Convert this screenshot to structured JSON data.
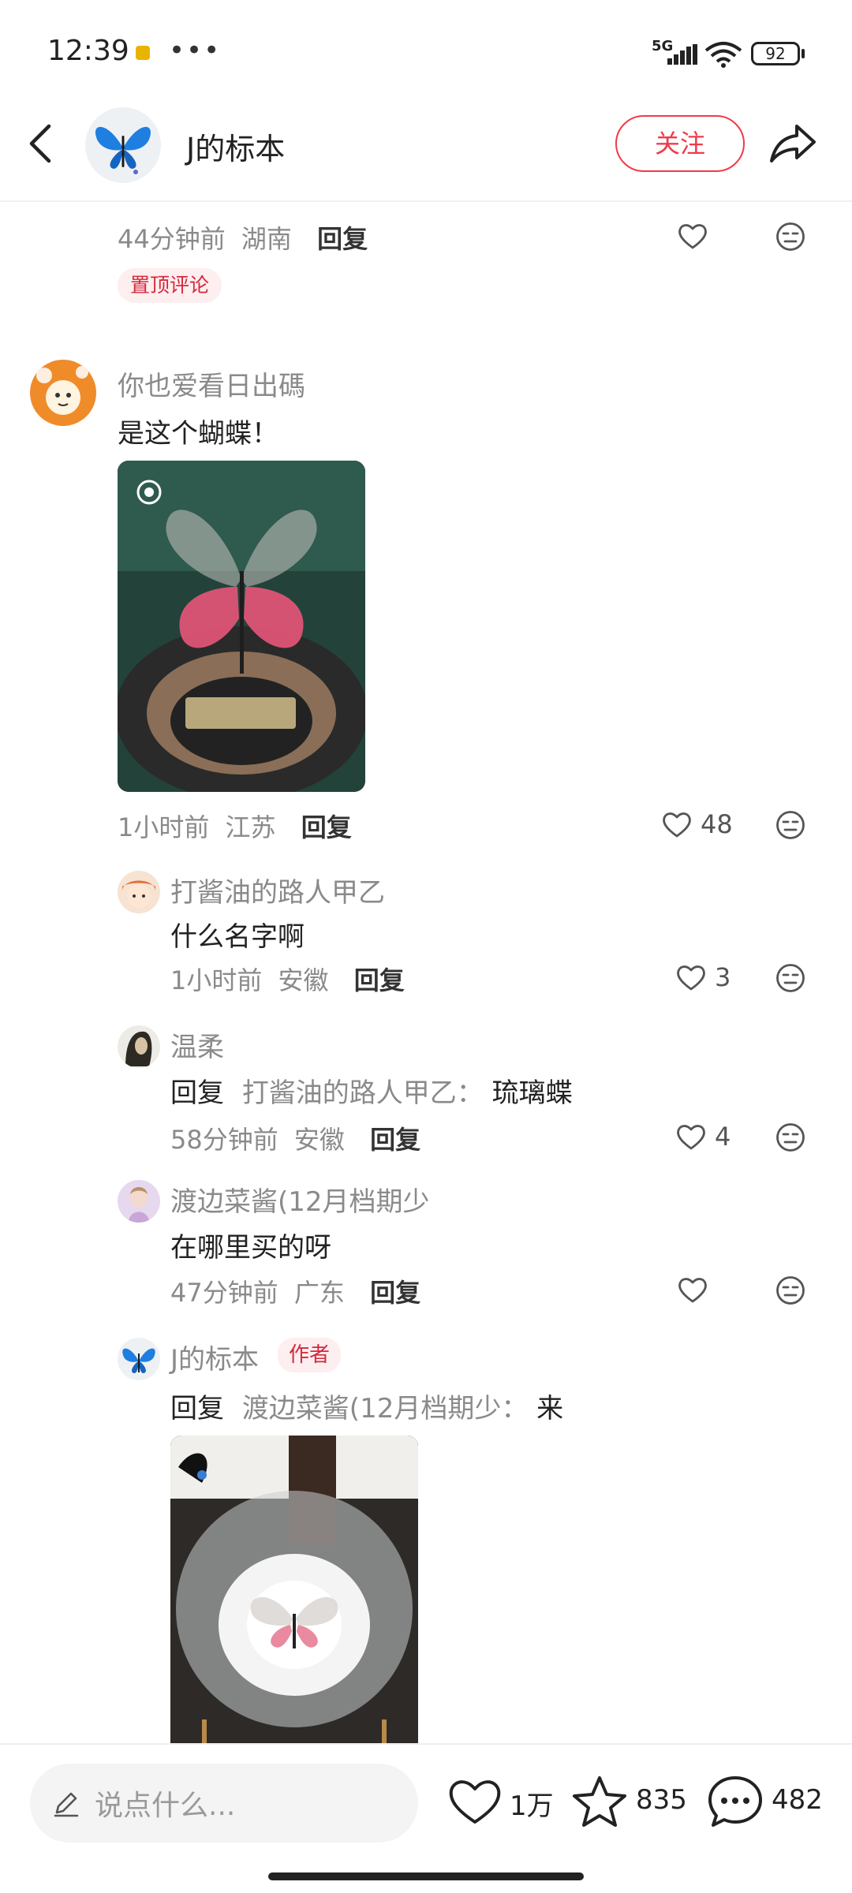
{
  "status": {
    "time": "12:39",
    "network": "5G",
    "battery": "92"
  },
  "header": {
    "author": "J的标本",
    "follow": "关注"
  },
  "pinned": {
    "time": "44分钟前",
    "location": "湖南",
    "reply": "回复",
    "badge": "置顶评论"
  },
  "comment1": {
    "user": "你也爱看日出碼",
    "text": "是这个蝴蝶！",
    "time": "1小时前",
    "location": "江苏",
    "reply": "回复",
    "likes": "48"
  },
  "replies": [
    {
      "user": "打酱油的路人甲乙",
      "text": "什么名字啊",
      "time": "1小时前",
      "location": "安徽",
      "reply": "回复",
      "likes": "3"
    },
    {
      "user": "温柔",
      "text_prefix": "回复",
      "text_target": "打酱油的路人甲乙：",
      "text_body": "琉璃蝶",
      "time": "58分钟前",
      "location": "安徽",
      "reply": "回复",
      "likes": "4"
    },
    {
      "user": "渡边菜酱(12月档期少",
      "text": "在哪里买的呀",
      "time": "47分钟前",
      "location": "广东",
      "reply": "回复",
      "likes": ""
    },
    {
      "user": "J的标本",
      "badge": "作者",
      "text_prefix": "回复",
      "text_target": "渡边菜酱(12月档期少：",
      "text_body": "来"
    }
  ],
  "bottom": {
    "placeholder": "说点什么...",
    "likes": "1万",
    "stars": "835",
    "comments": "482"
  },
  "colors": {
    "accent": "#ef3b4a",
    "muted": "#8a8a8a"
  }
}
